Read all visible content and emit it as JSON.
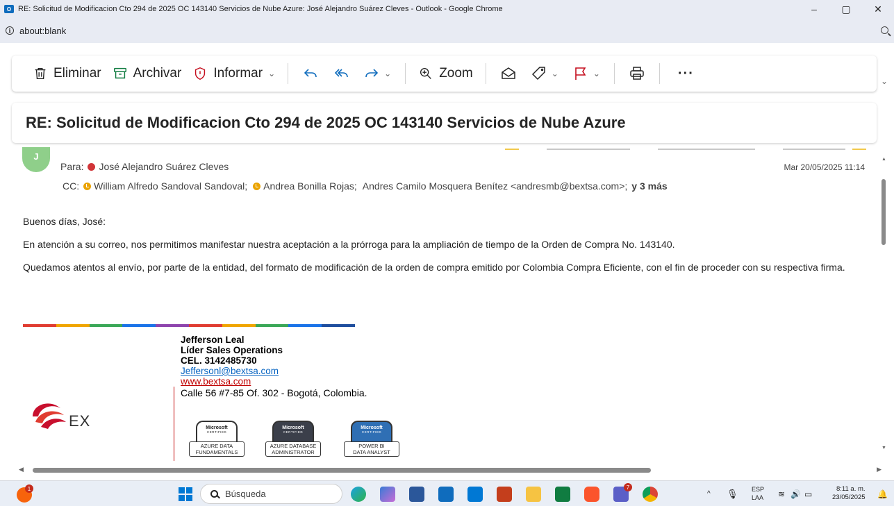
{
  "window": {
    "title": "RE: Solicitud de Modificacion Cto 294 de 2025 OC 143140 Servicios de Nube Azure: José Alejandro Suárez Cleves - Outlook - Google Chrome",
    "app_icon": "O",
    "minimize": "–",
    "restore": "▢",
    "close": "✕"
  },
  "address": {
    "url": "about:blank",
    "info_icon": "i"
  },
  "ribbon": {
    "delete_label": "Eliminar",
    "archive_label": "Archivar",
    "report_label": "Informar",
    "zoom_label": "Zoom",
    "more_label": "···",
    "chevron": "⌄"
  },
  "email": {
    "subject": "RE: Solicitud de Modificacion Cto 294 de 2025 OC 143140 Servicios de Nube Azure",
    "avatar_initial": "J",
    "to_prefix": "Para:",
    "to_name": "José Alejandro Suárez Cleves",
    "date": "Mar 20/05/2025 11:14",
    "cc_prefix": "CC:",
    "cc": [
      "William Alfredo Sandoval Sandoval;",
      "Andrea Bonilla Rojas;",
      "Andres Camilo Mosquera Benítez <andresmb@bextsa.com>;"
    ],
    "cc_more": "y 3 más",
    "body": [
      "Buenos días, José:",
      "En atención a su correo, nos permitimos manifestar nuestra aceptación a la prórroga para la ampliación de tiempo de la Orden de Compra No. 143140.",
      "Quedamos atentos al envío, por parte de la entidad, del formato de modificación de la orden de compra emitido por Colombia Compra Eficiente, con el fin de proceder con su respectiva firma."
    ]
  },
  "signature": {
    "name": "Jefferson Leal",
    "role": "Líder Sales Operations",
    "phone": "CEL. 3142485730",
    "email": "Jeffersonl@bextsa.com",
    "web": "www.bextsa.com",
    "address": "Calle 56 #7-85 Of. 302 - Bogotá, Colombia.",
    "logo_text": "EX",
    "line_colors": [
      "#e03c31",
      "#f0a500",
      "#3aa757",
      "#1a73e8",
      "#8e44ad",
      "#e03c31",
      "#f0a500",
      "#3aa757",
      "#1a73e8",
      "#1f4e9e"
    ],
    "badges": [
      {
        "brand": "Microsoft",
        "certified": "CERTIFIED",
        "line1": "AZURE DATA",
        "line2": "FUNDAMENTALS",
        "color": "#ffffff",
        "text": "#000000"
      },
      {
        "brand": "Microsoft",
        "certified": "CERTIFIED",
        "line1": "AZURE DATABASE",
        "line2": "ADMINISTRATOR",
        "color": "#3b3f4a",
        "text": "#ffffff"
      },
      {
        "brand": "Microsoft",
        "certified": "CERTIFIED",
        "line1": "POWER BI",
        "line2": "DATA ANALYST",
        "color": "#2f6fb4",
        "text": "#ffffff"
      }
    ]
  },
  "taskbar": {
    "search_placeholder": "Búsqueda",
    "notif_count": "1",
    "teams_count": "7",
    "lang_1": "ESP",
    "lang_2": "LAA",
    "time": "8:11 a. m.",
    "date": "23/05/2025",
    "tray_chevron": "^"
  }
}
